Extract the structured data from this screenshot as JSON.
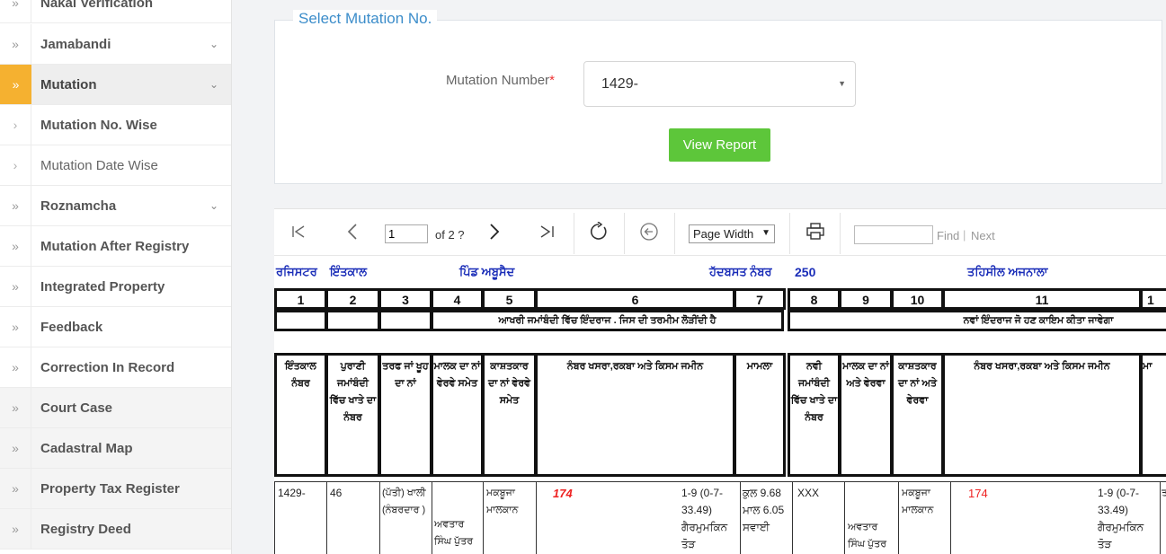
{
  "sidebar": {
    "items": [
      {
        "label": "Nakal Verification",
        "chevron": false
      },
      {
        "label": "Jamabandi",
        "chevron": true
      },
      {
        "label": "Mutation",
        "chevron": true
      },
      {
        "label": "Mutation No. Wise",
        "chevron": false
      },
      {
        "label": "Mutation Date Wise",
        "chevron": false
      },
      {
        "label": "Roznamcha",
        "chevron": true
      },
      {
        "label": "Mutation After Registry",
        "chevron": false
      },
      {
        "label": "Integrated Property",
        "chevron": false
      },
      {
        "label": "Feedback",
        "chevron": false
      },
      {
        "label": "Correction In Record",
        "chevron": false
      },
      {
        "label": "Court Case",
        "chevron": false
      },
      {
        "label": "Cadastral Map",
        "chevron": false
      },
      {
        "label": "Property Tax Register",
        "chevron": false
      },
      {
        "label": "Registry Deed",
        "chevron": false
      }
    ],
    "active_color": "#f5b130"
  },
  "panel": {
    "title": "Select Mutation No.",
    "field_label": "Mutation Number",
    "required_mark": "*",
    "selected_value": "1429-",
    "button_label": "View Report",
    "button_color": "#5dc63a"
  },
  "toolbar": {
    "page_value": "1",
    "page_of": "of 2 ?",
    "zoom_value": "Page Width",
    "find_label": "Find",
    "separator": "|",
    "next_label": "Next"
  },
  "report": {
    "register": "ਰਜਿਸਟਰ",
    "intkal": "ਇੰਤਕਾਲ",
    "pind": "ਪਿੰਡ ਅਬੂਸੈਦ",
    "hadbast_label": "ਹੱਦਬਸਤ ਨੰਬਰ",
    "hadbast_value": "250",
    "tehsil": "ਤਹਿਸੀਲ ਅਜਨਾਲਾ",
    "col_numbers": [
      "1",
      "2",
      "3",
      "4",
      "5",
      "6",
      "7",
      "8",
      "9",
      "10",
      "11",
      "1"
    ],
    "group_left": "ਆਖਰੀ ਜਮਾਂਬੰਦੀ ਵਿੱਚ ਇੰਦਰਾਜ . ਜਿਸ ਦੀ ਤਰਮੀਮ ਲੋੜੀਂਦੀ ਹੈ",
    "group_right": "ਨਵਾਂ ਇੰਦਰਾਜ ਜੋ ਹਣ ਕਾਇਮ ਕੀਤਾ ਜਾਵੇਗਾ",
    "headers": [
      "ਇੰਤਕਾਲ ਨੰਬਰ",
      "ਪੁਰਾਣੀ ਜਮਾਂਬੰਦੀ ਵਿੱਚ ਖਾਤੇ ਦਾ ਨੰਬਰ",
      "ਤਰਫ ਜਾਂ ਖੂਹ ਦਾ ਨਾਂ",
      "ਮਾਲਕ ਦਾ ਨਾਂ ਵੇਰਵੇ ਸਮੇਤ",
      "ਕਾਸ਼ਤਕਾਰ ਦਾ ਨਾਂ ਵੇਰਵੇ ਸਮੇਤ",
      "ਨੰਬਰ ਖਸਰਾ,ਰਕਬਾ ਅਤੇ ਕਿਸਮ ਜਮੀਨ",
      "ਮਾਮਲਾ",
      "ਨਵੀ ਜਮਾਂਬੰਦੀ ਵਿੱਚ ਖਾਤੇ ਦਾ ਨੰਬਰ",
      "ਮਾਲਕ ਦਾ ਨਾਂ ਅਤੇ ਵੇਰਵਾ",
      "ਕਾਸ਼ਤਕਾਰ ਦਾ ਨਾਂ ਅਤੇ ਵੇਰਵਾ",
      "ਨੰਬਰ ਖਸਰਾ,ਰਕਬਾ ਅਤੇ ਕਿਸਮ ਜਮੀਨ",
      "ਮਾ"
    ],
    "row": {
      "c1": "1429-",
      "c2": "46",
      "c3": "(ਪੱਤੀ) ਖਾਲੀ (ਨੰਬਰਦਾਰ )",
      "c4": "ਅਵਤਾਰ ਸਿੰਘ ਪੁੱਤਰ",
      "c5": "ਮਕਬੂਜਾ ਮਾਲਕਾਨ",
      "c6_num": "174",
      "c6_detail": "1-9 (0-7-33.49) ਗੈਰਮੁਮਕਿਨ ਤੋੜ",
      "c7": "ਕੁਲ 9.68 ਮਾਲ 6.05 ਸਵਾਈ",
      "c8": "XXX",
      "c9": "ਅਵਤਾਰ ਸਿੰਘ ਪੁੱਤਰ",
      "c10": "ਮਕਬੂਜਾ ਮਾਲਕਾਨ",
      "c11_num": "174",
      "c11_detail": "1-9 (0-7-33.49) ਗੈਰਮੁਮਕਿਨ ਤੋੜ",
      "c12": "ਤ"
    }
  }
}
